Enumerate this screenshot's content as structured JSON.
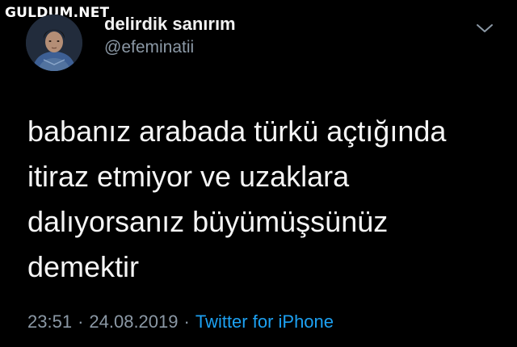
{
  "watermark": "GULDUM.NET",
  "user": {
    "display_name": "delirdik sanırım",
    "handle": "@efeminatii"
  },
  "icons": {
    "menu": "chevron-down-icon",
    "avatar": "profile-photo"
  },
  "tweet": {
    "lines": [
      "babanız arabada türkü açtığında",
      "itiraz etmiyor ve uzaklara",
      "dalıyorsanız büyümüşsünüz",
      "demektir"
    ],
    "time": "23:51",
    "date": "24.08.2019",
    "separator": "·",
    "source": "Twitter for iPhone"
  },
  "colors": {
    "background": "#000000",
    "text": "#f5f5f5",
    "muted": "#8b98a5",
    "link": "#1da1f2"
  }
}
